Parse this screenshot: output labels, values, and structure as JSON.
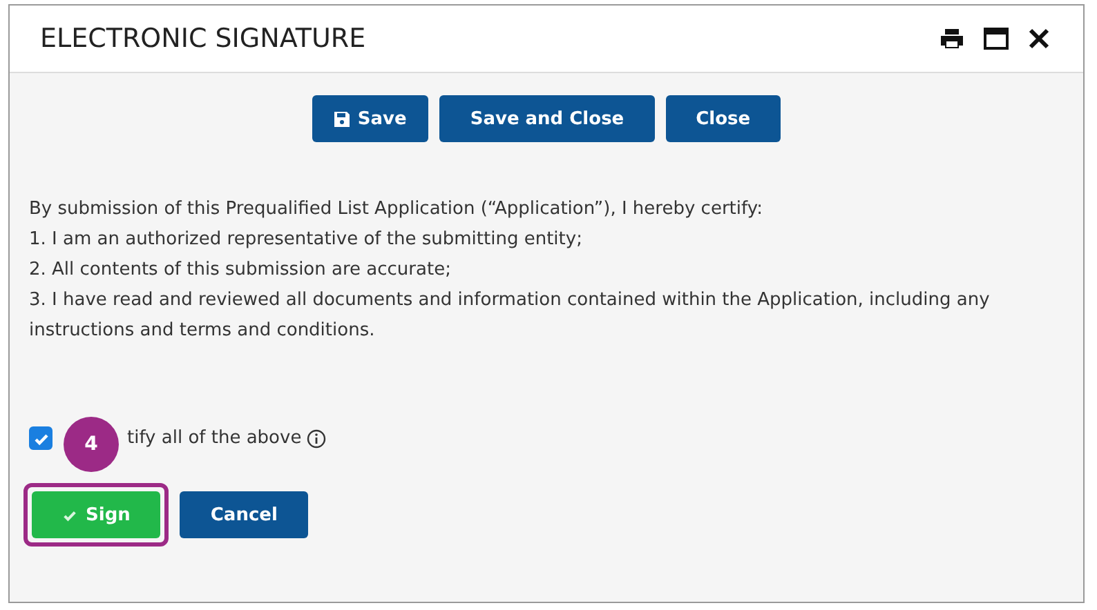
{
  "dialog": {
    "title": "ELECTRONIC SIGNATURE"
  },
  "toolbar": [
    {
      "label": "Save",
      "kind": "save"
    },
    {
      "label": "Save and Close",
      "kind": "plain"
    },
    {
      "label": "Close",
      "kind": "plain"
    }
  ],
  "statement": [
    "By submission of this Prequalified List Application (“Application”), I hereby certify:",
    "1. I am an authorized representative of the submitting entity;",
    "2. All contents of this submission are accurate;",
    "3. I have read and reviewed all documents and information contained within the Application, including any instructions and terms and conditions."
  ],
  "certify": {
    "label": "tify all of the above",
    "checked": true
  },
  "step_badge": "4",
  "actions": [
    {
      "label": "Sign",
      "kind": "primary",
      "highlighted": true
    },
    {
      "label": "Cancel",
      "kind": "secondary",
      "highlighted": false
    }
  ]
}
